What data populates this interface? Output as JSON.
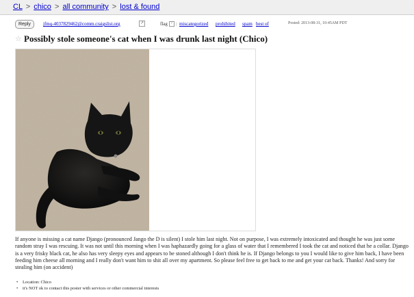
{
  "breadcrumb": {
    "items": [
      "CL",
      "chico",
      "all community",
      "lost & found"
    ],
    "separator": ">"
  },
  "meta": {
    "reply_label": "Reply",
    "email": "jfmq-4037829462@comm.craigslist.org",
    "flag_label": "flag",
    "flag_icon": "question-mark",
    "flag_colon": ":",
    "flag_options": [
      "miscategorized",
      "prohibited",
      "spam",
      "best of"
    ],
    "posted": "Posted: 2013-08-31, 10:45AM PDT"
  },
  "post": {
    "title": "Possibly stole someone's cat when I was drunk last night (Chico)",
    "star_icon": "star-outline",
    "body": "If anyone is missing a cat name Django (pronounced Jango the D is silent) I stole him last night. Not on purpose, I was extremely intoxicated and thought he was just some random stray I was rescuing. It was not until this morning when I was haphazardly going for a glass of water that I remembered I took the cat and noticed that he a collar. Django is a very frisky black cat, he also has very sleepy eyes and appears to be stoned although I don't think he is. If Django belongs to you I would like to give him back, I have been feeding him cheese all morning and I really don't want him to shit all over my apartment. So please feel free to get back to me and get your cat back. Thanks! And sorry for stealing him (on accident)",
    "notices": [
      "Location: Chico",
      "it's NOT ok to contact this poster with services or other commercial interests"
    ]
  },
  "colors": {
    "link": "#0000cc",
    "topbar_bg": "#efefef",
    "carpet": "#b9ab98",
    "cat": "#141414"
  }
}
